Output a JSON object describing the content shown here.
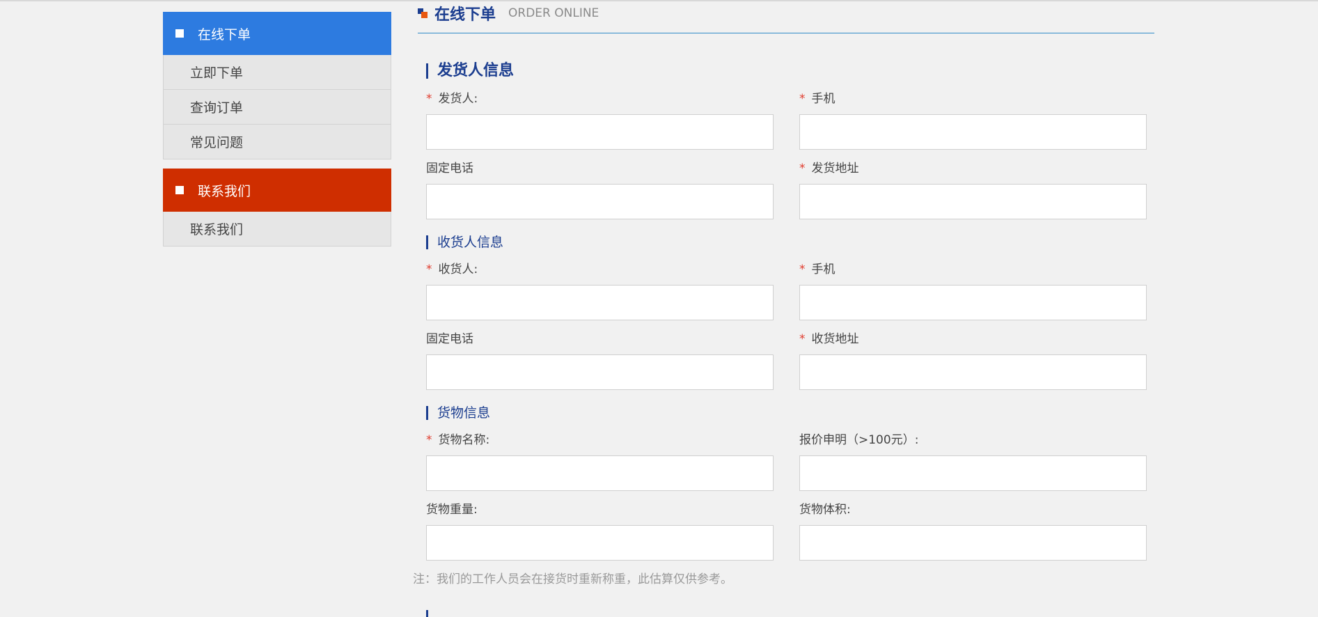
{
  "sidebar": {
    "groups": [
      {
        "header": "在线下单",
        "color": "#2d7be0",
        "items": [
          "立即下单",
          "查询订单",
          "常见问题"
        ]
      },
      {
        "header": "联系我们",
        "color": "#cf2e00",
        "items": [
          "联系我们"
        ]
      }
    ]
  },
  "header": {
    "title": "在线下单",
    "subtitle": "ORDER ONLINE"
  },
  "sender": {
    "title": "发货人信息",
    "name_label": "发货人:",
    "mobile_label": "手机",
    "phone_label": "固定电话",
    "address_label": "发货地址",
    "name_value": "",
    "mobile_value": "",
    "phone_value": "",
    "address_value": ""
  },
  "receiver": {
    "title": "收货人信息",
    "name_label": "收货人:",
    "mobile_label": "手机",
    "phone_label": "固定电话",
    "address_label": "收货地址",
    "name_value": "",
    "mobile_value": "",
    "phone_value": "",
    "address_value": ""
  },
  "goods": {
    "title": "货物信息",
    "name_label": "货物名称:",
    "insured_label": "报价申明（>100元）:",
    "weight_label": "货物重量:",
    "volume_label": "货物体积:",
    "name_value": "",
    "insured_value": "",
    "weight_value": "",
    "volume_value": ""
  },
  "required_mark": "*",
  "note": "注：我们的工作人员会在接货时重新称重，此估算仅供参考。",
  "colors": {
    "accent_blue": "#2d7be0",
    "accent_red": "#cf2e00",
    "title_navy": "#1b3d8f",
    "required": "#e03b2d"
  }
}
